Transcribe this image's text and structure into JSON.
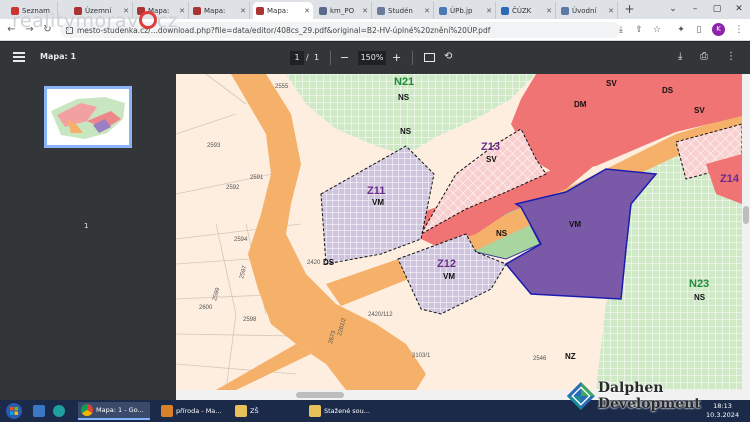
{
  "watermark": {
    "text_before": "realitymorav",
    "text_after": "cz"
  },
  "browser": {
    "tabs": [
      {
        "label": "Seznam",
        "color": "#cc3333"
      },
      {
        "label": "Územní",
        "color": "#a33"
      },
      {
        "label": "Mapa:",
        "color": "#a33"
      },
      {
        "label": "Mapa:",
        "color": "#a33"
      },
      {
        "label": "Mapa:",
        "color": "#a33"
      },
      {
        "label": "km_PO",
        "color": "#5a6a8a"
      },
      {
        "label": "Studén",
        "color": "#6a7a9a"
      },
      {
        "label": "ÚPb.jp",
        "color": "#4a7ab8"
      },
      {
        "label": "ČÚZK",
        "color": "#2a6ab8"
      },
      {
        "label": "Úvodní",
        "color": "#5a7aa8"
      }
    ],
    "url": "mesto-studenka.cz/...download.php?file=data/editor/408cs_29.pdf&original=B2-HV-úplné%20znění%20ÚP.pdf",
    "profile_initial": "K"
  },
  "pdf": {
    "title": "Mapa: 1",
    "page_current": "1",
    "page_separator": "/",
    "page_total": "1",
    "zoom": "150%",
    "thumbnail_label": "1"
  },
  "map": {
    "zones": [
      {
        "label": "N21",
        "type": "green-label"
      },
      {
        "label": "Z13",
        "type": "purple-label"
      },
      {
        "label": "Z11",
        "type": "purple-label"
      },
      {
        "label": "Z12",
        "type": "purple-label"
      },
      {
        "label": "Z14",
        "type": "purple-label"
      },
      {
        "label": "N23",
        "type": "green-label"
      }
    ],
    "codes": [
      "NS",
      "NS",
      "DM",
      "DS",
      "SV",
      "SV",
      "SV",
      "VM",
      "VM",
      "NS",
      "VM",
      "VM",
      "DS",
      "NS",
      "NZ"
    ],
    "parcels": [
      "2555",
      "2593",
      "2592",
      "2591",
      "2594",
      "2420",
      "2597",
      "2599",
      "2600",
      "2598",
      "2420/112",
      "2261/2",
      "2673",
      "3103/1",
      "2546"
    ],
    "colors": {
      "background": "#fdeee0",
      "orange_road": "#f5b06a",
      "green_mesh": "#c8e6c0",
      "red_zone": "#f07474",
      "pink_hatch": "#f8c8c8",
      "purple_vm": "#7a5aa8",
      "purple_hatch": "#ccc0dd",
      "label_green": "#1f8a3a",
      "label_purple": "#6a2b8a"
    }
  },
  "taskbar": {
    "apps": [
      {
        "label": "Mapa: 1 - Go...",
        "active": true
      },
      {
        "label": "příroda - Ma...",
        "active": false
      },
      {
        "label": "ZŠ",
        "active": false
      },
      {
        "label": "Stažené sou...",
        "active": false
      }
    ],
    "tray": [
      "LS"
    ],
    "time": "18:13",
    "date": "10.3.2024"
  },
  "brand": {
    "name": "Dalphen Development"
  }
}
